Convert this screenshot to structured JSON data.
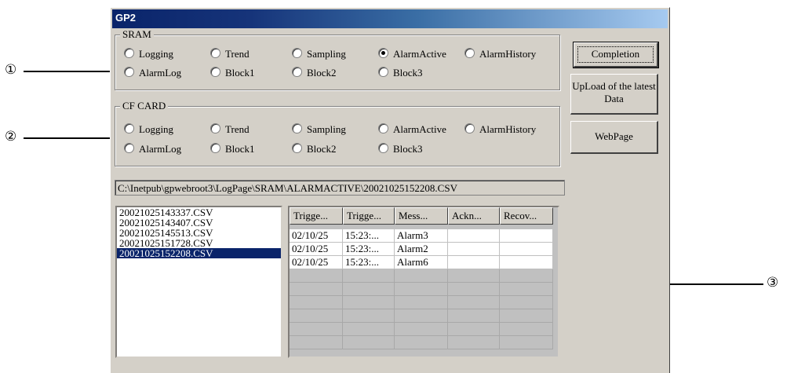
{
  "callouts": [
    "①",
    "②",
    "③"
  ],
  "window": {
    "title": "GP2"
  },
  "sram": {
    "legend": "SRAM",
    "options": [
      "Logging",
      "Trend",
      "Sampling",
      "AlarmActive",
      "AlarmHistory",
      "AlarmLog",
      "Block1",
      "Block2",
      "Block3"
    ],
    "selected": "AlarmActive"
  },
  "cf": {
    "legend": "CF CARD",
    "options": [
      "Logging",
      "Trend",
      "Sampling",
      "AlarmActive",
      "AlarmHistory",
      "AlarmLog",
      "Block1",
      "Block2",
      "Block3"
    ],
    "selected": ""
  },
  "buttons": {
    "completion": "Completion",
    "upload": "UpLoad of the latest Data",
    "webpage": "WebPage"
  },
  "path": "C:\\Inetpub\\gpwebroot3\\LogPage\\SRAM\\ALARMACTIVE\\20021025152208.CSV",
  "files": [
    "20021025143337.CSV",
    "20021025143407.CSV",
    "20021025145513.CSV",
    "20021025151728.CSV",
    "20021025152208.CSV"
  ],
  "selected_file": "20021025152208.CSV",
  "table": {
    "columns": [
      "Trigge...",
      "Trigge...",
      "Mess...",
      "Ackn...",
      "Recov..."
    ],
    "rows": [
      [
        "02/10/25",
        "15:23:...",
        "Alarm3",
        "",
        ""
      ],
      [
        "02/10/25",
        "15:23:...",
        "Alarm2",
        "",
        ""
      ],
      [
        "02/10/25",
        "15:23:...",
        "Alarm6",
        "",
        ""
      ]
    ]
  }
}
